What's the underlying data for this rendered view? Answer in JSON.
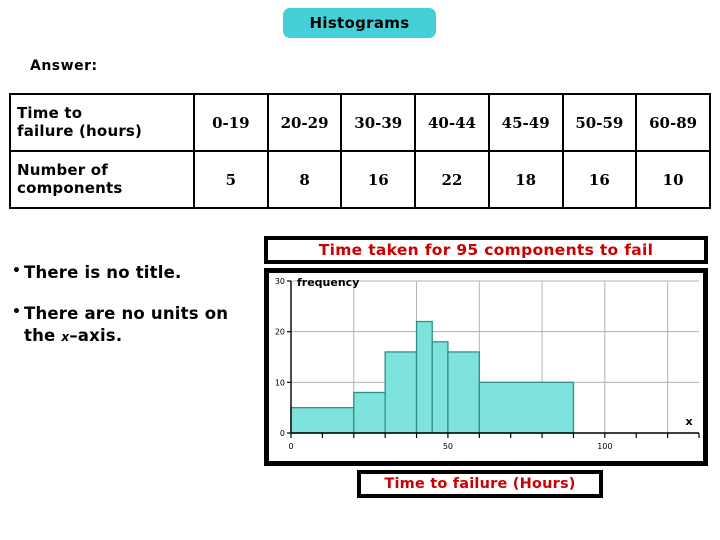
{
  "slide": {
    "title": "Histograms",
    "title_bg": "#45d0d8",
    "answer_label": "Answer:"
  },
  "table": {
    "row_headers": [
      "Time to failure (hours)",
      "Number of components"
    ],
    "row_header_lines": [
      [
        "Time to",
        "failure (hours)"
      ],
      [
        "Number of",
        "components"
      ]
    ],
    "intervals": [
      "0-19",
      "20-29",
      "30-39",
      "40-44",
      "45-49",
      "50-59",
      "60-89"
    ],
    "counts": [
      "5",
      "8",
      "16",
      "22",
      "18",
      "16",
      "10"
    ]
  },
  "bullets": [
    {
      "marker": "•",
      "text": "There is no title."
    },
    {
      "marker": "•",
      "text_before": "There are no units on the ",
      "var": "x",
      "text_after": "–axis."
    }
  ],
  "chart_title": {
    "text": "Time taken for 95 components to fail",
    "color": "#cc0000"
  },
  "xaxis_caption": {
    "text": "Time to failure (Hours)",
    "color": "#cc0000"
  },
  "chart_data": {
    "type": "bar",
    "title": "Time taken for 95 components to fail",
    "xlabel": "Time to failure (Hours)",
    "ylabel": "frequency",
    "x_axis_symbol": "x",
    "xlim": [
      0,
      130
    ],
    "ylim": [
      0,
      30
    ],
    "xticks": [
      0,
      10,
      20,
      30,
      40,
      50,
      60,
      70,
      80,
      90,
      100,
      110,
      120,
      130
    ],
    "xtick_labels": [
      "0",
      "",
      "",
      "",
      "",
      "50",
      "",
      "",
      "",
      "",
      "100",
      "",
      "",
      ""
    ],
    "yticks": [
      0,
      10,
      20,
      30
    ],
    "ytick_labels": [
      "0",
      "10",
      "20",
      "30"
    ],
    "grid": true,
    "gridlines_x": [
      20,
      40,
      60,
      80,
      100,
      120
    ],
    "gridlines_y": [
      10,
      20,
      30
    ],
    "bar_color": "#7ee3dc",
    "bar_edge_color": "#2f8f88",
    "categories": [
      "0-19",
      "20-29",
      "30-39",
      "40-44",
      "45-49",
      "50-59",
      "60-89"
    ],
    "bin_edges": [
      0,
      20,
      30,
      40,
      45,
      50,
      60,
      90
    ],
    "values": [
      5,
      8,
      16,
      22,
      18,
      16,
      10
    ],
    "note": "bar heights are frequency densities read off the y-axis"
  }
}
